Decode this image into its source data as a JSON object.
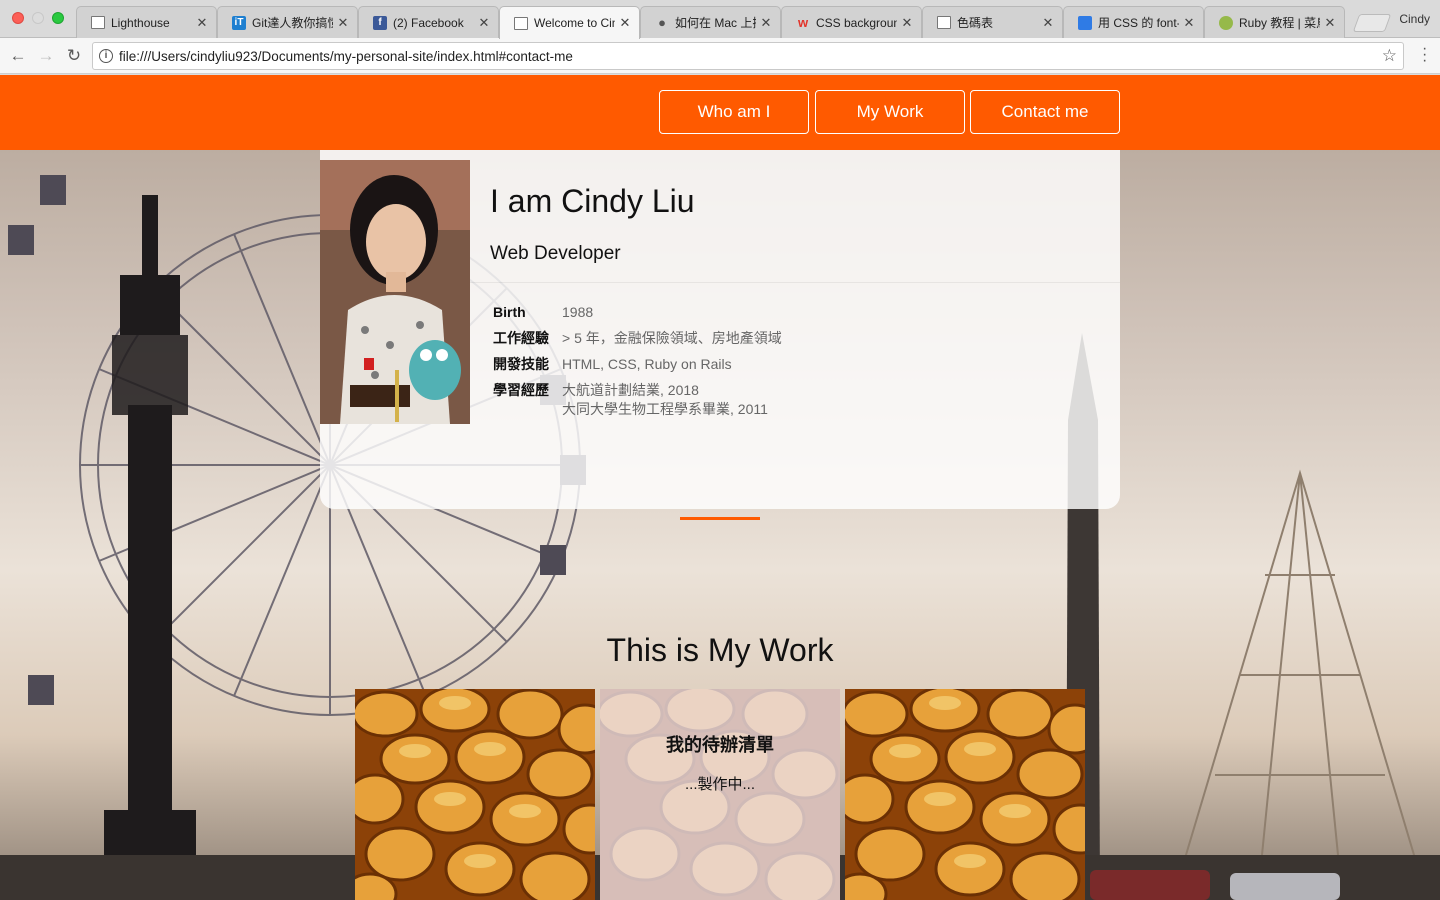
{
  "browser": {
    "profile_name": "Cindy",
    "url": "file:///Users/cindyliu923/Documents/my-personal-site/index.html#contact-me",
    "tabs": [
      {
        "label": "Lighthouse",
        "icon": "page-icon",
        "active": false
      },
      {
        "label": "Git達人教你搞懂",
        "icon": "ithome-icon",
        "active": false
      },
      {
        "label": "(2) Facebook",
        "icon": "facebook-icon",
        "active": false
      },
      {
        "label": "Welcome to Cindy",
        "icon": "page-icon",
        "active": true
      },
      {
        "label": "如何在 Mac 上插",
        "icon": "apple-icon",
        "active": false
      },
      {
        "label": "CSS background",
        "icon": "w3-icon",
        "active": false
      },
      {
        "label": "色碼表",
        "icon": "page-icon",
        "active": false
      },
      {
        "label": "用 CSS 的 font-",
        "icon": "blog-icon",
        "active": false
      },
      {
        "label": "Ruby 教程 | 菜鳥",
        "icon": "runoob-icon",
        "active": false
      }
    ]
  },
  "nav": {
    "who": "Who am I",
    "work": "My Work",
    "contact": "Contact me"
  },
  "profile": {
    "name": "I am Cindy Liu",
    "role": "Web Developer",
    "rows": [
      {
        "key": "Birth",
        "value": "1988"
      },
      {
        "key": "工作經驗",
        "value": "> 5 年，金融保險領域、房地產領域"
      },
      {
        "key": "開發技能",
        "value": "HTML, CSS, Ruby on Rails"
      },
      {
        "key": "學習經歷",
        "value": "大航道計劃結業, 2018",
        "value2": "大同大學生物工程學系畢業, 2011"
      }
    ]
  },
  "work": {
    "title": "This is My Work",
    "todo_title": "我的待辦清單",
    "todo_sub": "...製作中..."
  },
  "colors": {
    "accent": "#ff5a00"
  }
}
